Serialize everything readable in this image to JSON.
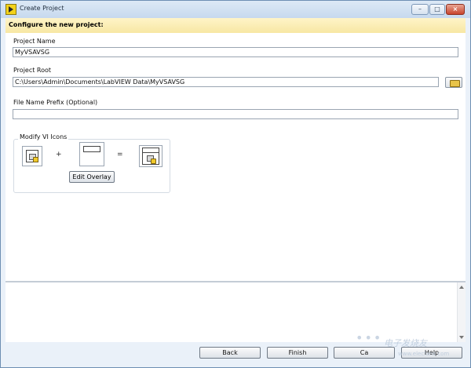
{
  "window": {
    "title": "Create Project"
  },
  "header": {
    "title": "Configure the new project:"
  },
  "form": {
    "project_name_label": "Project Name",
    "project_name_value": "MyVSAVSG",
    "project_root_label": "Project Root",
    "project_root_value": "C:\\Users\\Admin\\Documents\\LabVIEW Data\\MyVSAVSG",
    "prefix_label": "File Name Prefix (Optional)",
    "prefix_value": ""
  },
  "icons": {
    "group_title": "Modify VI Icons",
    "plus": "+",
    "equals": "=",
    "edit_overlay_label": "Edit Overlay"
  },
  "footer": {
    "back_label": "Back",
    "finish_label": "Finish",
    "cancel_label": "Ca",
    "help_label": "Help"
  },
  "watermark": {
    "text": "电子发烧友",
    "url": "www.elecfans.com"
  }
}
